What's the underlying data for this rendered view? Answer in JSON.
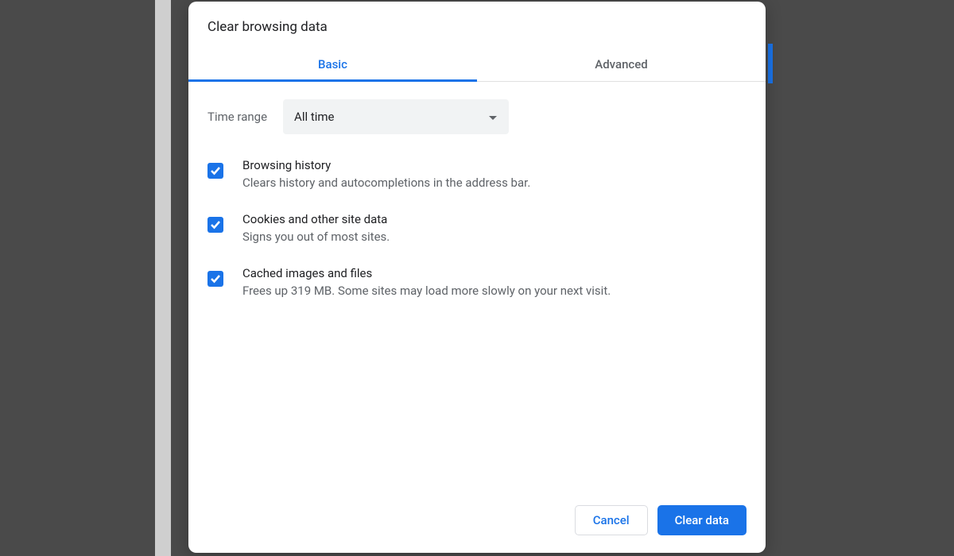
{
  "dialog": {
    "title": "Clear browsing data",
    "tabs": {
      "basic": "Basic",
      "advanced": "Advanced"
    },
    "timerange": {
      "label": "Time range",
      "value": "All time"
    },
    "options": [
      {
        "title": "Browsing history",
        "desc": "Clears history and autocompletions in the address bar."
      },
      {
        "title": "Cookies and other site data",
        "desc": "Signs you out of most sites."
      },
      {
        "title": "Cached images and files",
        "desc": "Frees up 319 MB. Some sites may load more slowly on your next visit."
      }
    ],
    "buttons": {
      "cancel": "Cancel",
      "clear": "Clear data"
    }
  }
}
